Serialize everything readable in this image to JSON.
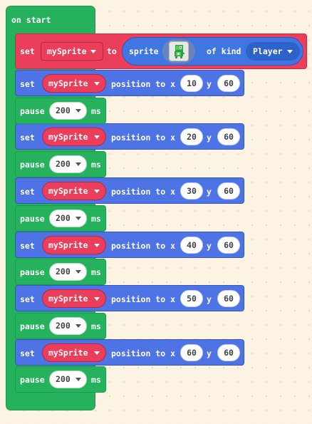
{
  "on_start": {
    "label": "on start"
  },
  "set_sprite": {
    "set_label": "set",
    "variable": "mySprite",
    "to_label": "to",
    "sprite_label": "sprite",
    "sprite_icon": "green-creature-sprite-icon",
    "kind_label": "of kind",
    "kind": "Player"
  },
  "position_rows": [
    {
      "set_label": "set",
      "variable": "mySprite",
      "text": "position to x",
      "x": "10",
      "y_label": "y",
      "y": "60"
    },
    {
      "set_label": "set",
      "variable": "mySprite",
      "text": "position to x",
      "x": "20",
      "y_label": "y",
      "y": "60"
    },
    {
      "set_label": "set",
      "variable": "mySprite",
      "text": "position to x",
      "x": "30",
      "y_label": "y",
      "y": "60"
    },
    {
      "set_label": "set",
      "variable": "mySprite",
      "text": "position to x",
      "x": "40",
      "y_label": "y",
      "y": "60"
    },
    {
      "set_label": "set",
      "variable": "mySprite",
      "text": "position to x",
      "x": "50",
      "y_label": "y",
      "y": "60"
    },
    {
      "set_label": "set",
      "variable": "mySprite",
      "text": "position to x",
      "x": "60",
      "y_label": "y",
      "y": "60"
    }
  ],
  "pause_rows": [
    {
      "label": "pause",
      "value": "200",
      "unit": "ms"
    },
    {
      "label": "pause",
      "value": "200",
      "unit": "ms"
    },
    {
      "label": "pause",
      "value": "200",
      "unit": "ms"
    },
    {
      "label": "pause",
      "value": "200",
      "unit": "ms"
    },
    {
      "label": "pause",
      "value": "200",
      "unit": "ms"
    },
    {
      "label": "pause",
      "value": "200",
      "unit": "ms"
    }
  ],
  "colors": {
    "events_green": "#26b15c",
    "variables_red": "#ea3e5a",
    "sprites_blue": "#4d73e4",
    "workspace": "#fdf3e2"
  }
}
